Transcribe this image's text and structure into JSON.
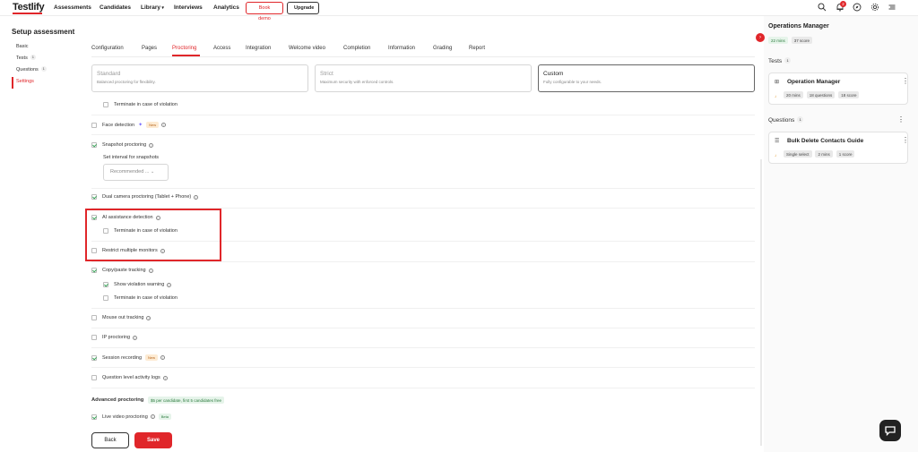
{
  "brand": {
    "name": "Testlify",
    "accent": "#e0262a"
  },
  "nav": {
    "items": [
      "Assessments",
      "Candidates",
      "Library",
      "Interviews",
      "Analytics"
    ],
    "book_demo": "Book demo",
    "upgrade": "Upgrade",
    "notification_count": "2",
    "icons": [
      "search-icon",
      "bell-icon",
      "compass-icon",
      "gear-icon",
      "menu-icon"
    ]
  },
  "sidebar": {
    "title": "Setup assessment",
    "items": [
      {
        "label": "Basic",
        "count": ""
      },
      {
        "label": "Tests",
        "count": "1"
      },
      {
        "label": "Questions",
        "count": "1"
      },
      {
        "label": "Settings",
        "count": ""
      }
    ]
  },
  "tabs": [
    "Configuration",
    "Pages",
    "Proctoring",
    "Access",
    "Integration",
    "Welcome video",
    "Completion",
    "Information",
    "Grading",
    "Report"
  ],
  "modes": [
    {
      "title": "Standard",
      "desc": "Balanced proctoring for flexibility."
    },
    {
      "title": "Strict",
      "desc": "Maximum security with enforced controls."
    },
    {
      "title": "Custom",
      "desc": "Fully configurable to your needs."
    }
  ],
  "options": {
    "terminate_1": "Terminate in case of violation",
    "face_detection": "Face detection",
    "new_badge": "New",
    "snapshot": "Snapshot proctoring",
    "interval_label": "Set interval for snapshots",
    "interval_value": "Recommended ...",
    "dual_camera": "Dual camera proctoring (Tablet + Phone)",
    "ai_assist": "AI assistance detection",
    "terminate_2": "Terminate in case of violation",
    "multi_monitor": "Restrict multiple monitors",
    "copy_paste": "Copy/paste tracking",
    "show_warning": "Show violation warning",
    "terminate_3": "Terminate in case of violation",
    "mouse_out": "Mouse out tracking",
    "ip_proctoring": "IP proctoring",
    "session_recording": "Session recording",
    "question_logs": "Question level activity logs",
    "advanced_title": "Advanced proctoring",
    "advanced_badge": "$5 per candidate, first 5 candidates free",
    "live_video": "Live video proctoring",
    "beta_badge": "Beta"
  },
  "buttons": {
    "back": "Back",
    "save": "Save"
  },
  "right_panel": {
    "title": "Operations Manager",
    "mins": "22 mins",
    "score": "37 score",
    "tests_label": "Tests",
    "tests_count": "1",
    "test_card": {
      "title": "Operation Manager",
      "pills": [
        "20 mins",
        "18 questions",
        "18 score"
      ]
    },
    "questions_label": "Questions",
    "questions_count": "1",
    "question_card": {
      "title": "Bulk Delete Contacts Guide",
      "pills": [
        "Single select",
        "2 mins",
        "1 score"
      ]
    }
  }
}
